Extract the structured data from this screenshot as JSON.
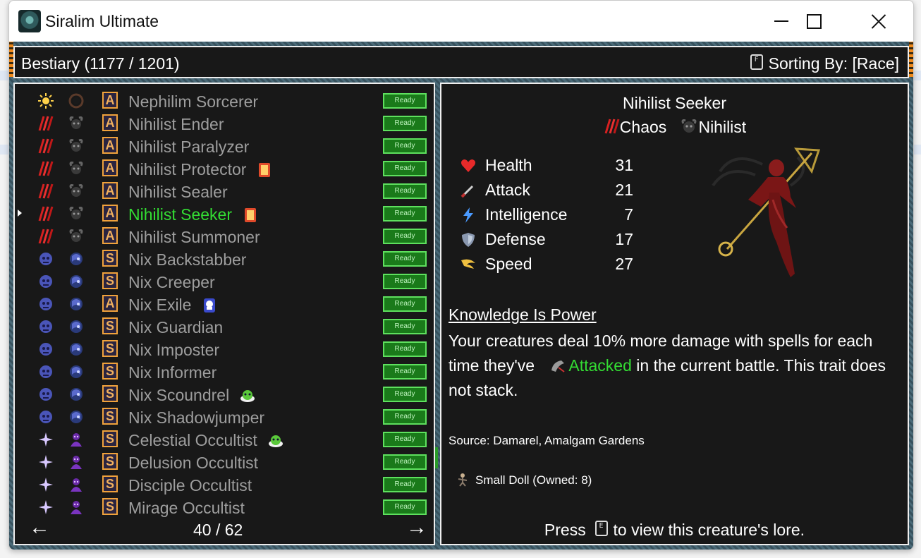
{
  "window": {
    "title": "Siralim Ultimate"
  },
  "header": {
    "title": "Bestiary (1177 / 1201)",
    "sort_key": "F",
    "sort_label": "Sorting By: [Race]"
  },
  "list": {
    "ready_label": "Ready",
    "page": "40 / 62",
    "items": [
      {
        "name": "Nephilim Sorcerer",
        "class": "life",
        "race": "nephilim",
        "rank": "A",
        "badge": ""
      },
      {
        "name": "Nihilist Ender",
        "class": "chaos",
        "race": "nihilist",
        "rank": "A",
        "badge": ""
      },
      {
        "name": "Nihilist Paralyzer",
        "class": "chaos",
        "race": "nihilist",
        "rank": "A",
        "badge": ""
      },
      {
        "name": "Nihilist Protector",
        "class": "chaos",
        "race": "nihilist",
        "rank": "A",
        "badge": "card"
      },
      {
        "name": "Nihilist Sealer",
        "class": "chaos",
        "race": "nihilist",
        "rank": "A",
        "badge": ""
      },
      {
        "name": "Nihilist Seeker",
        "class": "chaos",
        "race": "nihilist",
        "rank": "A",
        "badge": "card",
        "selected": true
      },
      {
        "name": "Nihilist Summoner",
        "class": "chaos",
        "race": "nihilist",
        "rank": "A",
        "badge": ""
      },
      {
        "name": "Nix Backstabber",
        "class": "death",
        "race": "nix",
        "rank": "S",
        "badge": ""
      },
      {
        "name": "Nix Creeper",
        "class": "death",
        "race": "nix",
        "rank": "S",
        "badge": ""
      },
      {
        "name": "Nix Exile",
        "class": "death",
        "race": "nix",
        "rank": "A",
        "badge": "ghost"
      },
      {
        "name": "Nix Guardian",
        "class": "death",
        "race": "nix",
        "rank": "S",
        "badge": ""
      },
      {
        "name": "Nix Imposter",
        "class": "death",
        "race": "nix",
        "rank": "S",
        "badge": ""
      },
      {
        "name": "Nix Informer",
        "class": "death",
        "race": "nix",
        "rank": "S",
        "badge": ""
      },
      {
        "name": "Nix Scoundrel",
        "class": "death",
        "race": "nix",
        "rank": "S",
        "badge": "slime"
      },
      {
        "name": "Nix Shadowjumper",
        "class": "death",
        "race": "nix",
        "rank": "S",
        "badge": ""
      },
      {
        "name": "Celestial Occultist",
        "class": "sorcery",
        "race": "occultist",
        "rank": "S",
        "badge": "slime"
      },
      {
        "name": "Delusion Occultist",
        "class": "sorcery",
        "race": "occultist",
        "rank": "S",
        "badge": ""
      },
      {
        "name": "Disciple Occultist",
        "class": "sorcery",
        "race": "occultist",
        "rank": "S",
        "badge": ""
      },
      {
        "name": "Mirage Occultist",
        "class": "sorcery",
        "race": "occultist",
        "rank": "S",
        "badge": ""
      }
    ]
  },
  "detail": {
    "name": "Nihilist Seeker",
    "class": "Chaos",
    "race": "Nihilist",
    "stats": [
      {
        "label": "Health",
        "value": "31",
        "icon": "heart-icon"
      },
      {
        "label": "Attack",
        "value": "21",
        "icon": "sword-icon"
      },
      {
        "label": "Intelligence",
        "value": "7",
        "icon": "lightning-icon"
      },
      {
        "label": "Defense",
        "value": "17",
        "icon": "shield-icon"
      },
      {
        "label": "Speed",
        "value": "27",
        "icon": "wing-icon"
      }
    ],
    "trait": {
      "name": "Knowledge Is Power",
      "desc_before": "Your creatures deal 10% more damage with spells for each time they've",
      "desc_keyword": "Attacked",
      "desc_after": "in the current battle. This trait does not stack."
    },
    "source": "Source: Damarel, Amalgam Gardens",
    "item": "Small Doll (Owned: 8)",
    "lore_before": "Press",
    "lore_key": "E",
    "lore_after": "to view this creature's lore."
  },
  "colors": {
    "selected": "#33dd33",
    "dimmed": "#9e9e9e",
    "ready_bg": "#1a7a1a",
    "panel": "#181818"
  }
}
